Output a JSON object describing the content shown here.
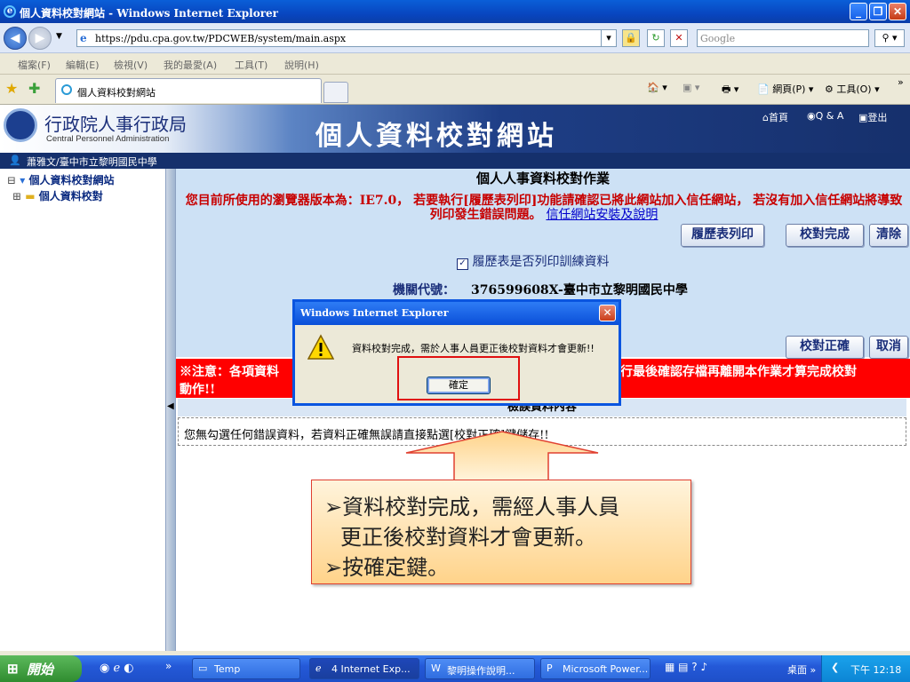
{
  "browser": {
    "window_title": "個人資料校對網站 - Windows Internet Explorer",
    "url": "https://pdu.cpa.gov.tw/PDCWEB/system/main.aspx",
    "search_placeholder": "Google",
    "menu": [
      "檔案(F)",
      "編輯(E)",
      "檢視(V)",
      "我的最愛(A)",
      "工具(T)",
      "說明(H)"
    ],
    "tab_title": "個人資料校對網站",
    "toolbar_page": "網頁(P)",
    "toolbar_tools": "工具(O)"
  },
  "site": {
    "org_name": "行政院人事行政局",
    "org_name_en": "Central Personnel Administration",
    "title": "個人資料校對網站",
    "links": {
      "home": "首頁",
      "qa": "Q & A",
      "logout": "登出"
    },
    "user": "蕭雅文/臺中市立黎明國民中學"
  },
  "sidebar": {
    "root": "個人資料校對網站",
    "child": "個人資料校對"
  },
  "main": {
    "heading": "個人人事資料校對作業",
    "browser_notice": "您目前所使用的瀏覽器版本為：IE7.0， 若要執行[履歷表列印]功能請確認已將此網站加入信任網站， 若沒有加入信任網站將導致列印發生錯誤問題。",
    "notice_link": "信任網站安裝及說明",
    "print_button": "履歷表列印",
    "done_button": "校對完成",
    "clear_button": "清除",
    "training_checkbox": "履歷表是否列印訓練資料",
    "agency_code_label": "機關代號：",
    "agency_code_value": "376599608X-臺中市立黎明國民中學",
    "confirm_button": "校對正確",
    "cancel_button": "取消",
    "note_part1": "※注意：各項資料",
    "note_part2": "行最後確認存檔再離開本作業才算完成校對",
    "note_line2": "動作!!",
    "error_heading": "檢誤資料內容",
    "error_message": "您無勾選任何錯誤資料，若資料正確無誤請直接點選[校對正確]鍵儲存!!"
  },
  "dialog": {
    "title": "Windows Internet Explorer",
    "message": "資料校對完成，需於人事人員更正後校對資料才會更新!!",
    "ok": "確定"
  },
  "callout": {
    "line1": "➢資料校對完成，需經人事人員",
    "line2": "更正後校對資料才會更新。",
    "line3": "➢按確定鍵。"
  },
  "taskbar": {
    "start": "開始",
    "items": [
      "Temp",
      "4 Internet Exp...",
      "黎明操作說明...",
      "Microsoft Power..."
    ],
    "desktop": "桌面",
    "clock": "下午 12:18"
  }
}
